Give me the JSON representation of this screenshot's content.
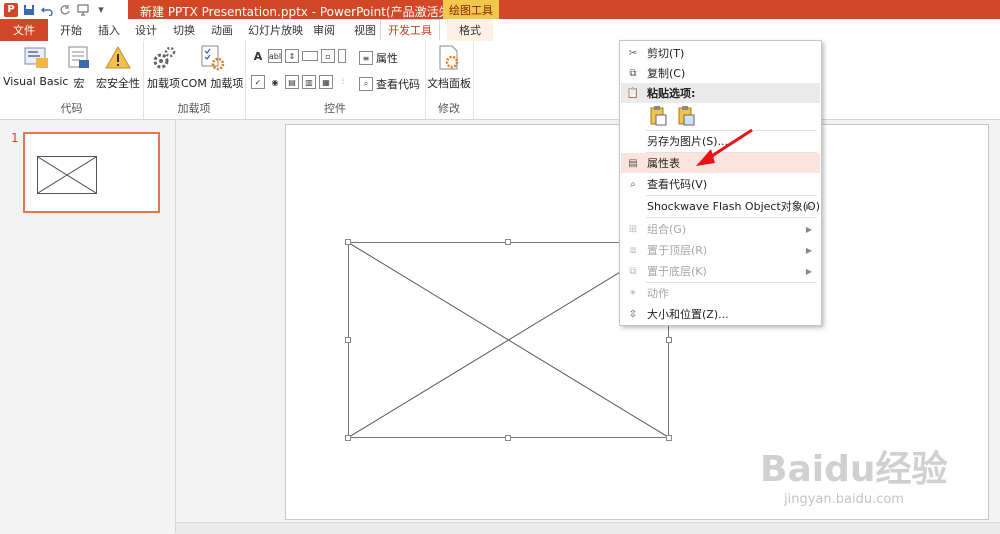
{
  "window": {
    "title": "新建 PPTX Presentation.pptx -  PowerPoint(产品激活失败)",
    "contextual_group": "绘图工具",
    "app_icon_letter": "P",
    "qat_icons": [
      "save-icon",
      "undo-icon",
      "redo-icon",
      "presentation-icon"
    ]
  },
  "tabs": [
    {
      "label": "文件"
    },
    {
      "label": "开始"
    },
    {
      "label": "插入"
    },
    {
      "label": "设计"
    },
    {
      "label": "切换"
    },
    {
      "label": "动画"
    },
    {
      "label": "幻灯片放映"
    },
    {
      "label": "审阅"
    },
    {
      "label": "视图"
    },
    {
      "label": "开发工具"
    },
    {
      "label": "格式"
    }
  ],
  "ribbon": {
    "code_group": {
      "label": "代码",
      "visual_basic": "Visual Basic",
      "macro": "宏",
      "macro_security": "宏安全性"
    },
    "addins_group": {
      "label": "加载项",
      "addins": "加载项",
      "com_addins": "COM 加载项"
    },
    "controls_group": {
      "label": "控件",
      "properties": "属性",
      "view_code": "查看代码"
    },
    "modify_group": {
      "label": "修改",
      "document_panel": "文档面板"
    }
  },
  "slides_pane": {
    "slide_number": "1"
  },
  "context_menu": {
    "cut": "剪切(T)",
    "copy": "复制(C)",
    "paste_options": "粘贴选项:",
    "save_as_picture": "另存为图片(S)...",
    "property_sheet": "属性表",
    "view_code": "查看代码(V)",
    "flash_object": "Shockwave Flash Object对象(O)",
    "group": "组合(G)",
    "bring_to_front": "置于顶层(R)",
    "send_to_back": "置于底层(K)",
    "action": "动作",
    "size_position": "大小和位置(Z)..."
  },
  "watermark": {
    "main": "Baidu经验",
    "sub": "jingyan.baidu.com"
  },
  "colors": {
    "accent": "#d24726",
    "highlight": "#fce4de",
    "arrow": "#e8131a"
  }
}
